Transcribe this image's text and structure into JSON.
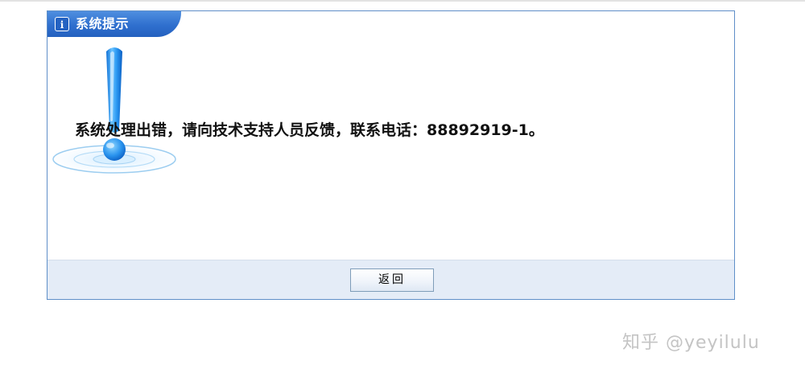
{
  "dialog": {
    "title": "系统提示",
    "info_icon_glyph": "i",
    "alert_icon": "exclamation-icon",
    "message": "系统处理出错，请向技术支持人员反馈，联系电话：88892919-1。",
    "back_button_label": "返回"
  },
  "watermark": {
    "text": "知乎 @yeyilulu"
  },
  "colors": {
    "title_bar": "#2f6fce",
    "dialog_border": "#5f8fc8",
    "footer_bg": "#e4ecf7",
    "exclamation_blue": "#1e90f0"
  }
}
